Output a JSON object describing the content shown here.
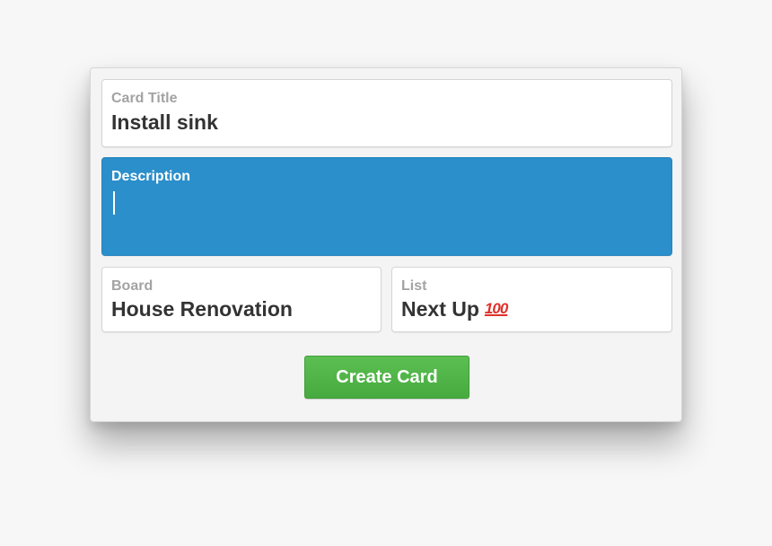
{
  "form": {
    "card_title": {
      "label": "Card Title",
      "value": "Install sink"
    },
    "description": {
      "label": "Description",
      "value": "",
      "focused": true
    },
    "board": {
      "label": "Board",
      "value": "House Renovation"
    },
    "list": {
      "label": "List",
      "value": "Next Up",
      "emoji_icon": "hundred-points-emoji-icon",
      "emoji_text": "100"
    },
    "create_button_label": "Create Card"
  },
  "colors": {
    "focus_blue": "#2a8fcb",
    "button_green": "#52b648",
    "label_gray": "#a3a3a3",
    "value_dark": "#333333",
    "emoji_red": "#e0302a"
  }
}
